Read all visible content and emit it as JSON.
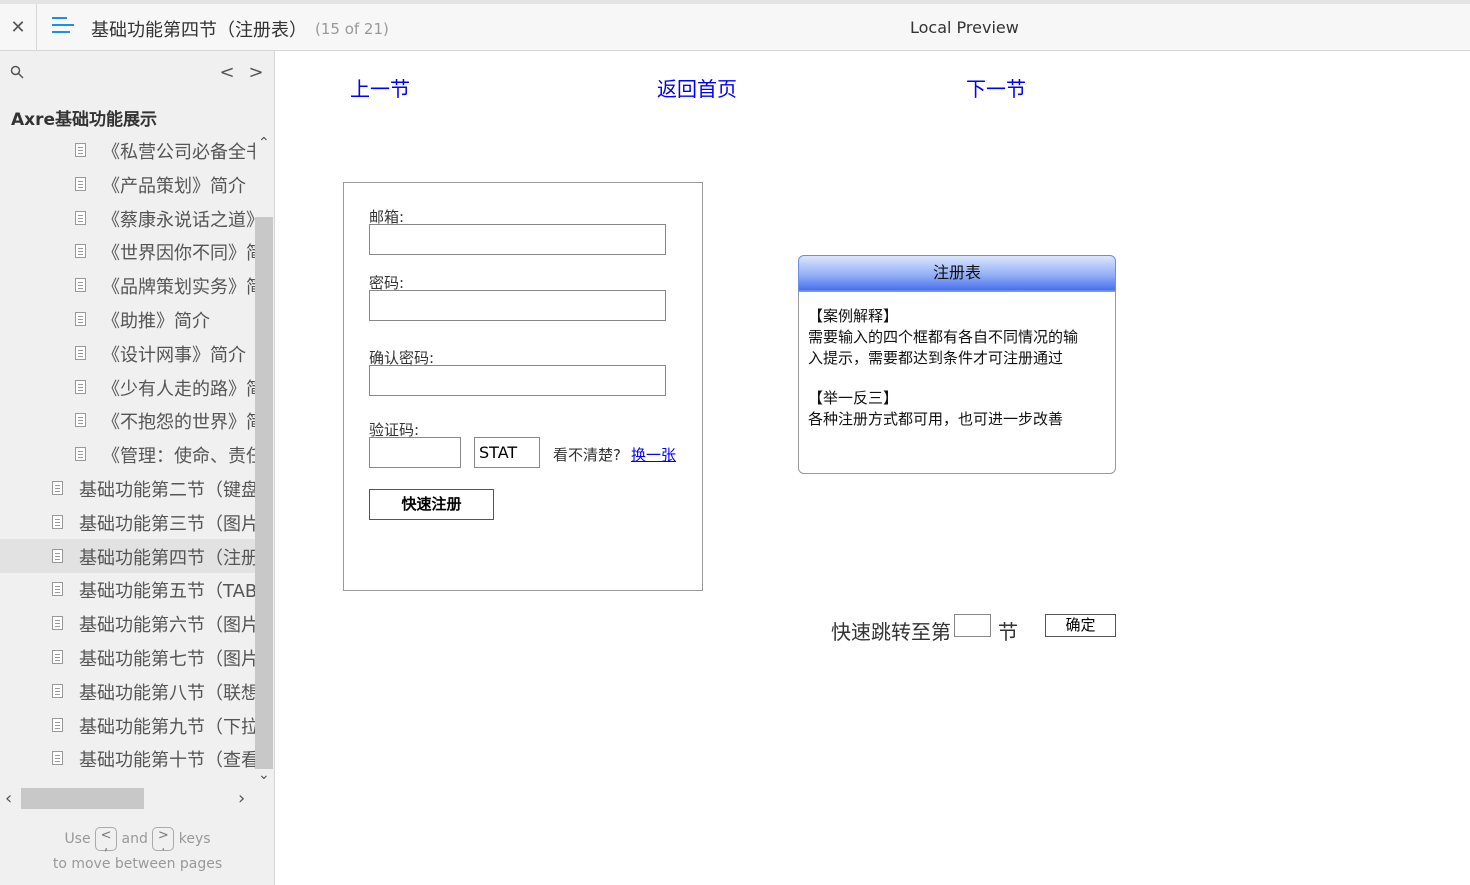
{
  "header": {
    "close_label": "✕",
    "title": "基础功能第四节（注册表）",
    "page_count": "(15 of 21)",
    "preview_label": "Local Preview"
  },
  "sidebar": {
    "prev_label": "<",
    "next_label": ">",
    "root_label": "Axre基础功能展示",
    "items": [
      {
        "label": "《私营公司必备全书"
      },
      {
        "label": "《产品策划》简介"
      },
      {
        "label": "《蔡康永说话之道》"
      },
      {
        "label": "《世界因你不同》简"
      },
      {
        "label": "《品牌策划实务》简"
      },
      {
        "label": "《助推》简介"
      },
      {
        "label": "《设计网事》简介"
      },
      {
        "label": "《少有人走的路》简"
      },
      {
        "label": "《不抱怨的世界》简"
      },
      {
        "label": "《管理：使命、责任"
      },
      {
        "label": "基础功能第二节（键盘"
      },
      {
        "label": "基础功能第三节（图片"
      },
      {
        "label": "基础功能第四节（注册"
      },
      {
        "label": "基础功能第五节（TAB标"
      },
      {
        "label": "基础功能第六节（图片"
      },
      {
        "label": "基础功能第七节（图片"
      },
      {
        "label": "基础功能第八节（联想"
      },
      {
        "label": "基础功能第九节（下拉"
      },
      {
        "label": "基础功能第十节（查看"
      }
    ],
    "selected_index": 12,
    "hint": {
      "use": "Use",
      "key_prev": "<\n,",
      "and": "and",
      "key_next": ">\n.",
      "keys": "keys",
      "line2": "to move between pages"
    }
  },
  "content": {
    "nav": {
      "prev": "上一节",
      "home": "返回首页",
      "next": "下一节"
    },
    "form": {
      "email_label": "邮箱:",
      "password_label": "密码:",
      "confirm_label": "确认密码:",
      "captcha_label": "验证码:",
      "captcha_code": "STAT",
      "captcha_hint": "看不清楚?",
      "captcha_refresh": "换一张",
      "register_button": "快速注册"
    },
    "note": {
      "title": "注册表",
      "section1_title": "【案例解释】",
      "section1_line1": "需要输入的四个框都有各自不同情况的输",
      "section1_line2": "入提示，需要都达到条件才可注册通过",
      "section2_title": "【举一反三】",
      "section2_line1": "各种注册方式都可用，也可进一步改善"
    },
    "jump": {
      "label": "快速跳转至第",
      "suffix": "节",
      "button": "确定"
    }
  }
}
